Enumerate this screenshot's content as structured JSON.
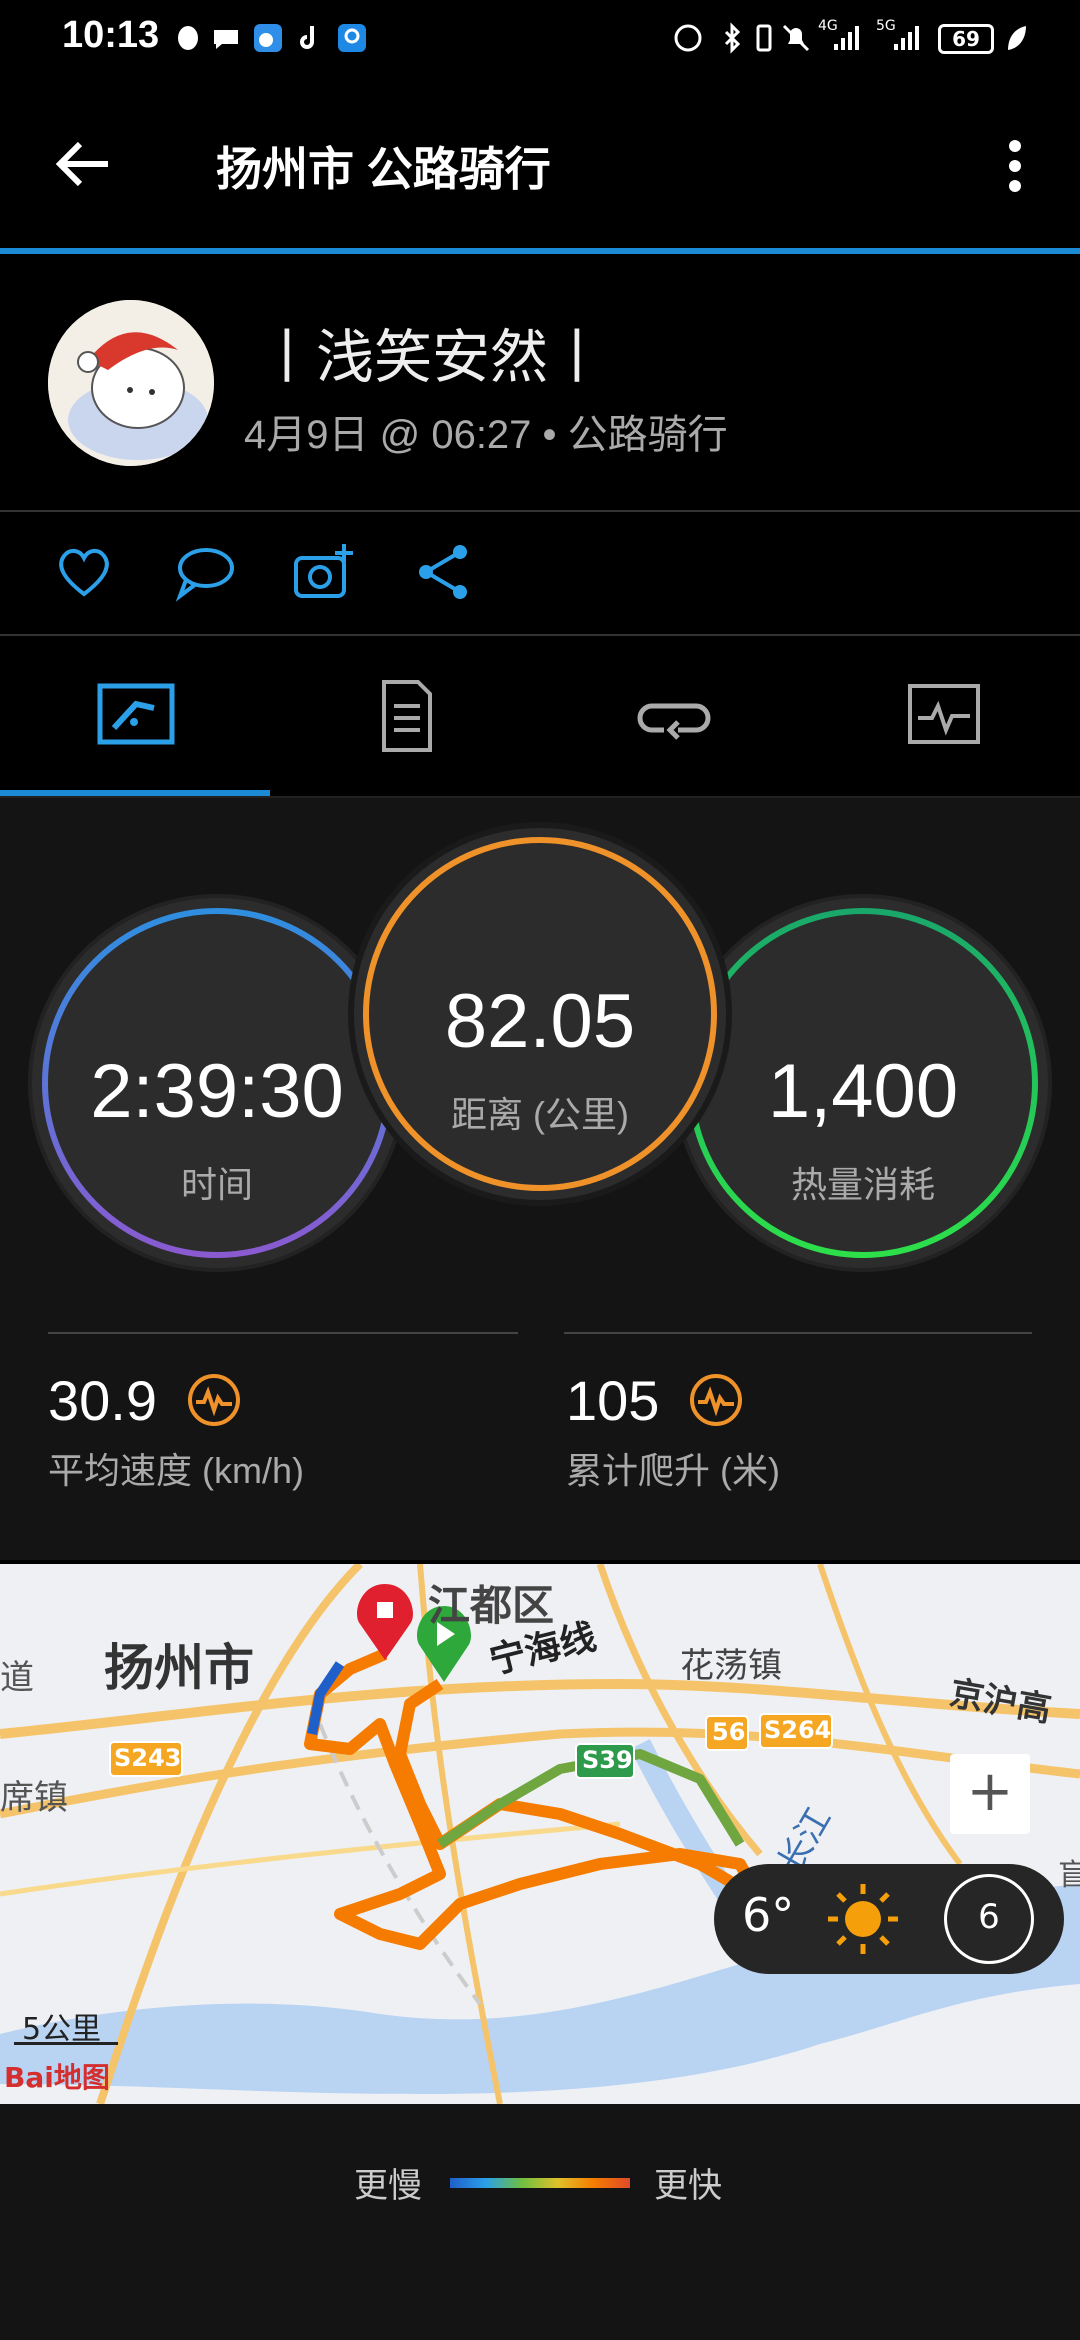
{
  "status_bar": {
    "time": "10:13",
    "battery": "69",
    "network_4g": "4G",
    "network_5g": "5G"
  },
  "app_bar": {
    "title": "扬州市 公路骑行",
    "back_icon": "arrow-left-icon",
    "menu_icon": "more-vert-icon"
  },
  "profile": {
    "username": "丨浅笑安然丨",
    "subline": "4月9日 @ 06:27 • 公路骑行"
  },
  "actions": [
    "heart-icon",
    "comment-icon",
    "add-photo-icon",
    "share-icon"
  ],
  "tabs": [
    "overview-icon",
    "details-icon",
    "laps-icon",
    "charts-icon"
  ],
  "stats": {
    "time": {
      "value": "2:39:30",
      "label": "时间"
    },
    "distance": {
      "value": "82.05",
      "label": "距离 (公里)"
    },
    "calories": {
      "value": "1,400",
      "label": "热量消耗"
    },
    "avg_speed": {
      "value": "30.9",
      "label": "平均速度 (km/h)"
    },
    "climb": {
      "value": "105",
      "label": "累计爬升 (米)"
    }
  },
  "map": {
    "labels": {
      "jiangdu": "江都区",
      "yangzhou": "扬州市",
      "ninghai": "宁海线",
      "huadang": "花荡镇",
      "jinghu": "京沪高",
      "s243": "S243",
      "s39": "S39",
      "s264": "S264",
      "s56": "56",
      "river": "长江",
      "left_dao": "道",
      "left_zhen": "席镇",
      "right_yan": "盲"
    },
    "scale": "5公里",
    "brand": "Bai地图",
    "zoom_in": "+",
    "weather": {
      "temp": "6°",
      "wind": "6"
    },
    "colors": {
      "route_slow": "#1f5fc9",
      "route_mid": "#8bc34a",
      "route_fast": "#f57c00",
      "river": "#b9d3f2"
    }
  },
  "legend": {
    "slow": "更慢",
    "fast": "更快"
  }
}
